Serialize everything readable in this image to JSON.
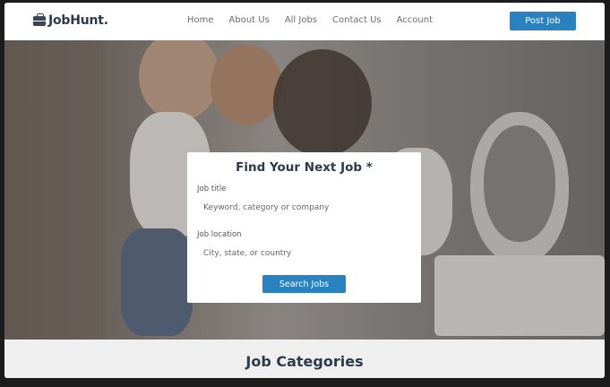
{
  "brand": {
    "name": "JobHunt.",
    "icon": "briefcase-icon"
  },
  "nav": {
    "items": [
      {
        "label": "Home"
      },
      {
        "label": "About Us"
      },
      {
        "label": "All Jobs"
      },
      {
        "label": "Contact Us"
      },
      {
        "label": "Account"
      }
    ],
    "cta_label": "Post Job"
  },
  "search": {
    "title": "Find Your Next Job *",
    "job_title_label": "Job title",
    "job_title_placeholder": "Keyword, category or company",
    "job_title_value": "",
    "location_label": "Job location",
    "location_placeholder": "City, state, or country",
    "location_value": "",
    "submit_label": "Search Jobs"
  },
  "categories": {
    "title": "Job Categories"
  },
  "colors": {
    "accent": "#2a81c0",
    "text_dark": "#2b3a4c"
  }
}
